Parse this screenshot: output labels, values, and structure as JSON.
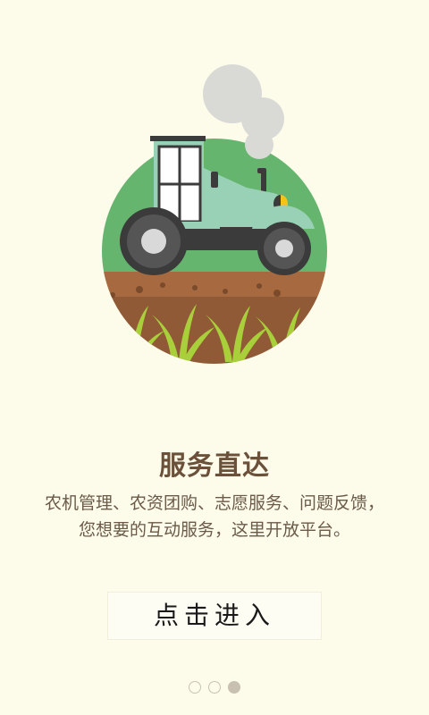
{
  "main": {
    "title": "服务直达",
    "description_line1": "农机管理、农资团购、志愿服务、问题反馈，",
    "description_line2": "您想要的互动服务，这里开放平台。",
    "enter_button_label": "点击进入"
  },
  "illustration": {
    "icon": "tractor-illustration"
  },
  "pager": {
    "page_count": 3,
    "active_page": 3
  },
  "colors": {
    "background": "#fdfbea",
    "title": "#6b5139",
    "field_green": "#65b56f",
    "soil": "#8f5a35",
    "tractor_body": "#99d1b6"
  }
}
